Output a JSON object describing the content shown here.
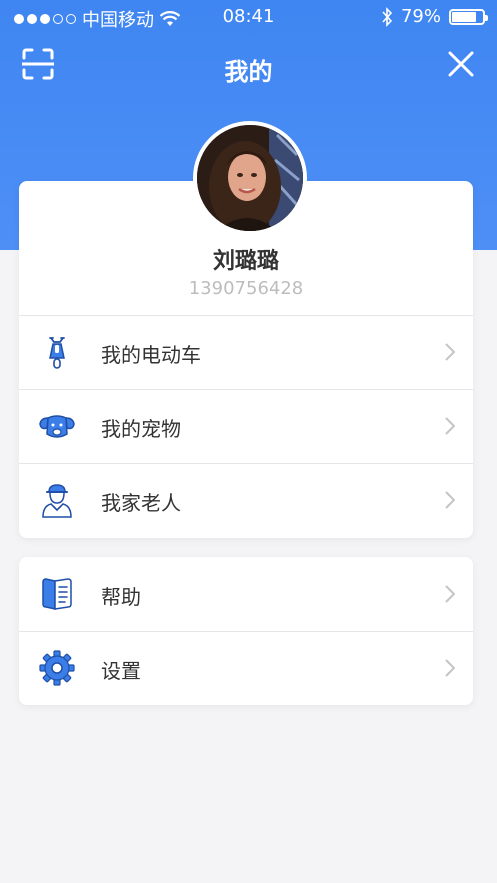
{
  "status_bar": {
    "carrier": "中国移动",
    "time": "08:41",
    "battery": "79%",
    "battery_level": 0.79
  },
  "nav": {
    "title": "我的",
    "left_icon": "scan-icon",
    "right_icon": "close-icon"
  },
  "profile": {
    "name": "刘璐璐",
    "phone": "1390756428"
  },
  "menu": [
    {
      "label": "我的电动车",
      "icon": "scooter-icon"
    },
    {
      "label": "我的宠物",
      "icon": "dog-icon"
    },
    {
      "label": "我家老人",
      "icon": "elder-icon"
    }
  ],
  "help_menu": [
    {
      "label": "帮助",
      "icon": "book-icon"
    },
    {
      "label": "设置",
      "icon": "gear-icon"
    }
  ],
  "colors": {
    "header": "#4a8bf5",
    "icon_blue": "#3c7ee8",
    "background": "#f4f4f6"
  }
}
